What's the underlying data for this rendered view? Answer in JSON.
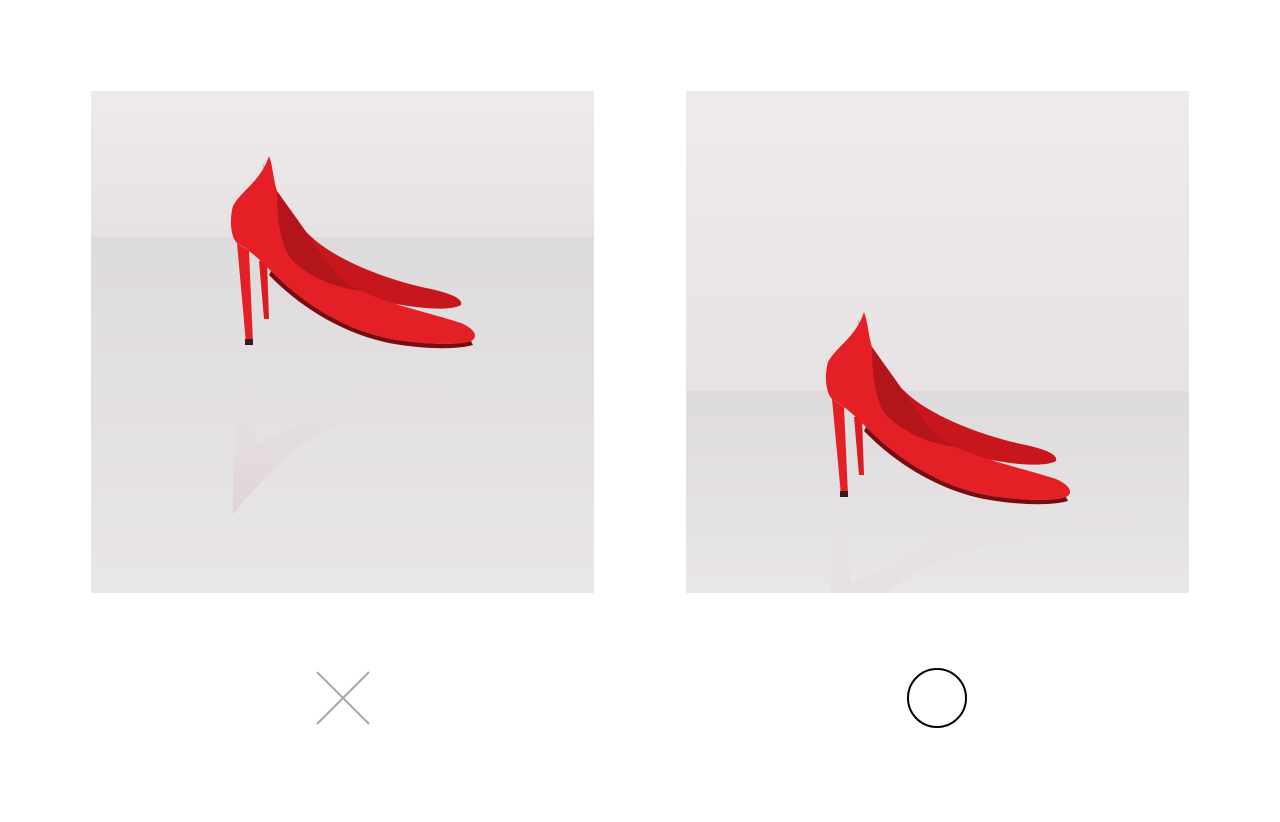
{
  "comparison": {
    "incorrect": {
      "photo_subject": "red-suede-pumps-small-margin",
      "verdict_icon": "x-icon",
      "icon_color": "#a9a9a9"
    },
    "correct": {
      "photo_subject": "red-suede-pumps-balanced-margin",
      "verdict_icon": "circle-icon",
      "icon_color": "#000000"
    }
  },
  "colors": {
    "backdrop_wall": "#ece7e8",
    "backdrop_floor": "#e4e1e2",
    "shoe_red": "#e41f25",
    "shoe_shadow": "#a8141a",
    "page_background": "#ffffff"
  }
}
